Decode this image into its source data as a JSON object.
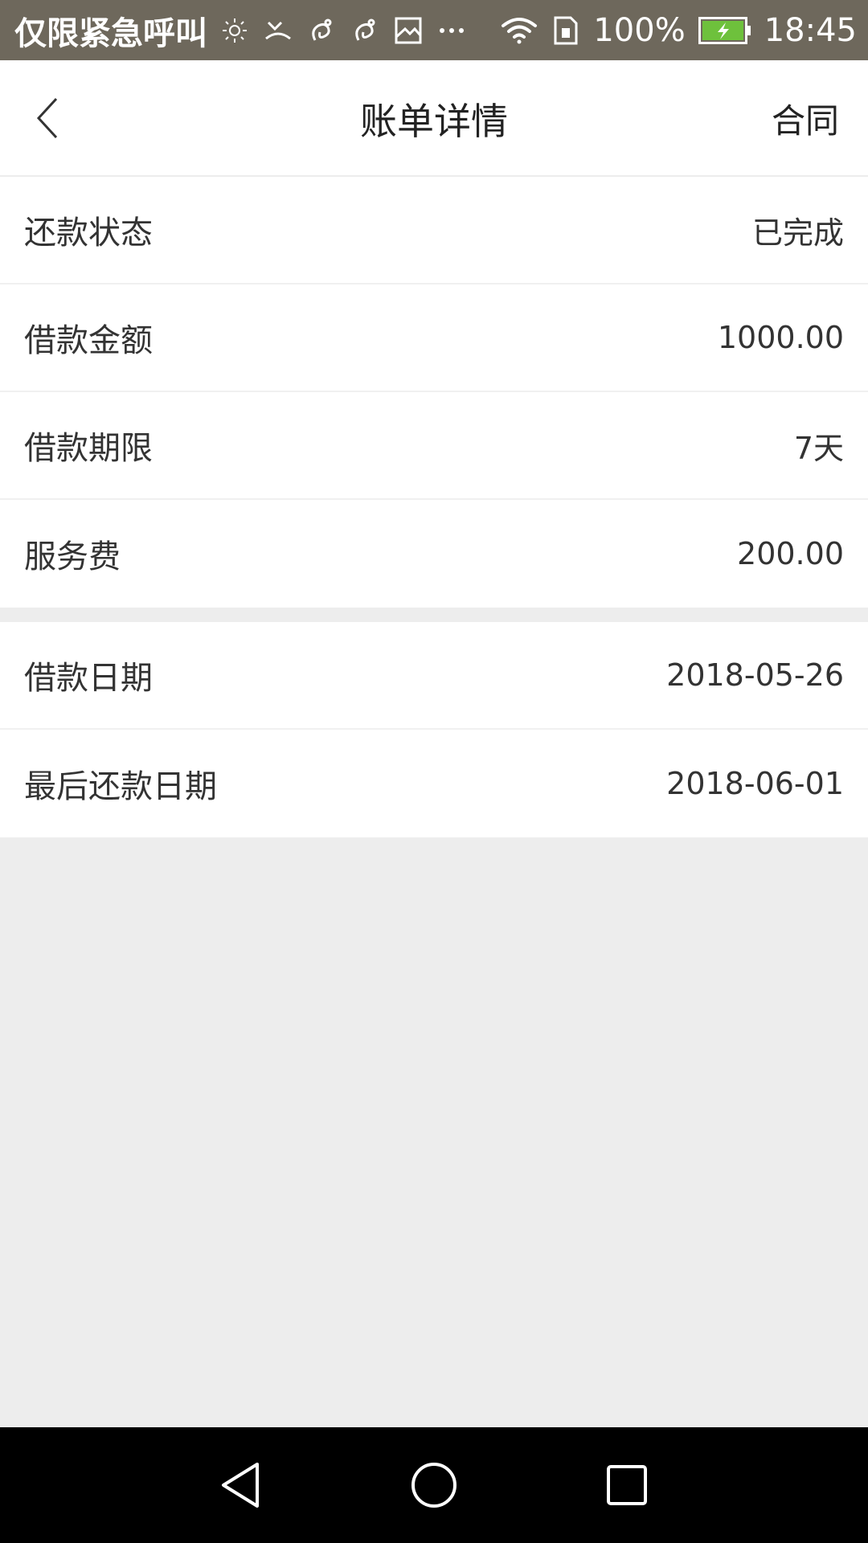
{
  "status_bar": {
    "carrier": "仅限紧急呼叫",
    "battery": "100%",
    "time": "18:45",
    "icons": [
      "brightness-icon",
      "missed-call-icon",
      "squirrel-app-icon",
      "squirrel-app-icon",
      "image-icon",
      "more-notifications-icon",
      "wifi-icon",
      "sim-icon",
      "battery-charging-icon"
    ]
  },
  "header": {
    "title": "账单详情",
    "right_action": "合同"
  },
  "details": {
    "group1": [
      {
        "label": "还款状态",
        "value": "已完成"
      },
      {
        "label": "借款金额",
        "value": "1000.00"
      },
      {
        "label": "借款期限",
        "value": "7天"
      },
      {
        "label": "服务费",
        "value": "200.00"
      }
    ],
    "group2": [
      {
        "label": "借款日期",
        "value": "2018-05-26"
      },
      {
        "label": "最后还款日期",
        "value": "2018-06-01"
      }
    ]
  },
  "colors": {
    "status_bar_bg": "#6e685c",
    "page_bg": "#ededed",
    "card_bg": "#ffffff",
    "text": "#333333",
    "battery_green": "#6ec13c"
  }
}
